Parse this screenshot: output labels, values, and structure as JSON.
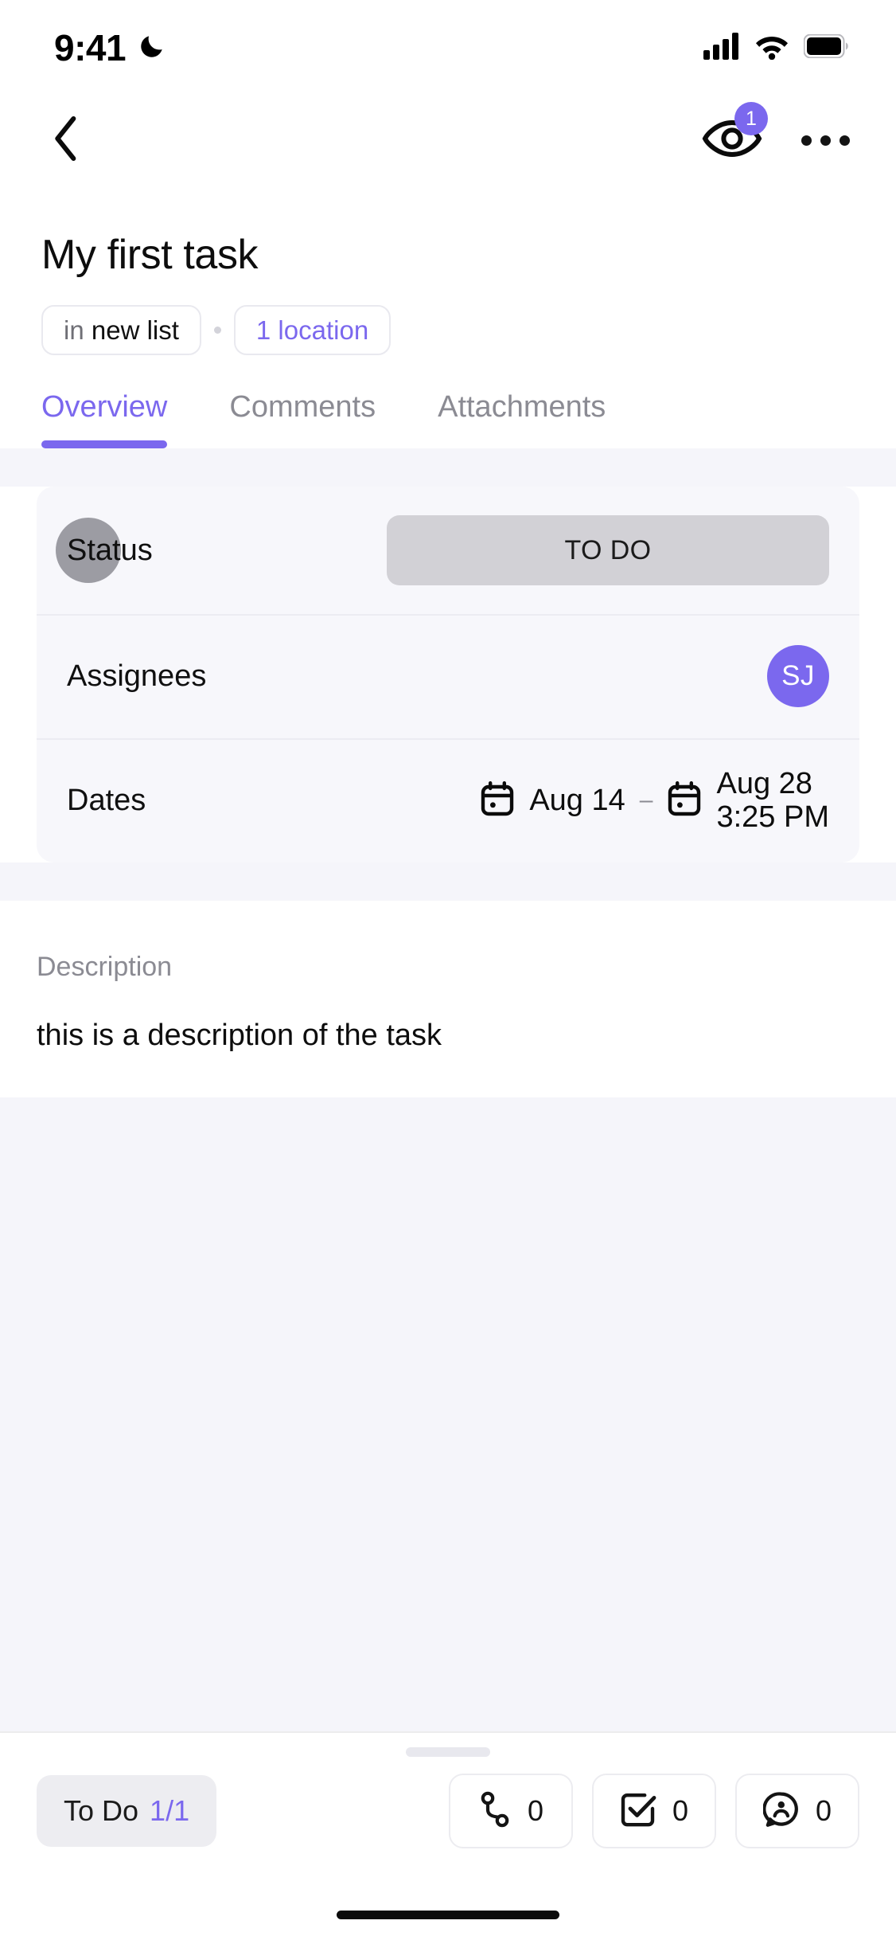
{
  "status_bar": {
    "time": "9:41",
    "dnd_icon": "moon-icon",
    "signal_icon": "cellular-signal-icon",
    "wifi_icon": "wifi-icon",
    "battery_icon": "battery-icon"
  },
  "nav": {
    "back_icon": "chevron-left-icon",
    "watchers_icon": "eye-icon",
    "watchers_count": "1",
    "more_icon": "ellipsis-icon"
  },
  "task": {
    "title": "My first task",
    "list_pill_prefix": "in",
    "list_pill_name": "new list",
    "location_pill": "1 location"
  },
  "tabs": [
    {
      "label": "Overview",
      "active": true
    },
    {
      "label": "Comments",
      "active": false
    },
    {
      "label": "Attachments",
      "active": false
    }
  ],
  "fields": {
    "status": {
      "label": "Status",
      "value": "TO DO",
      "dot_color": "#9c9ca3",
      "chip_color": "#d2d1d6"
    },
    "assignees": {
      "label": "Assignees",
      "avatar_initials": "SJ",
      "avatar_color": "#7b68ee"
    },
    "dates": {
      "label": "Dates",
      "start_icon": "calendar-icon",
      "start": "Aug 14",
      "separator": "–",
      "end_icon": "calendar-icon",
      "end_date": "Aug 28",
      "end_time": "3:25 PM"
    }
  },
  "description": {
    "label": "Description",
    "text": "this is a description of the task"
  },
  "bottom_bar": {
    "todo_label": "To Do",
    "todo_count": "1/1",
    "actions": [
      {
        "icon": "relationship-icon",
        "count": "0"
      },
      {
        "icon": "checklist-icon",
        "count": "0"
      },
      {
        "icon": "mention-comment-icon",
        "count": "0"
      }
    ]
  },
  "colors": {
    "accent": "#7b68ee",
    "surface": "#f7f7fb",
    "page_bg": "#f5f5fa"
  }
}
